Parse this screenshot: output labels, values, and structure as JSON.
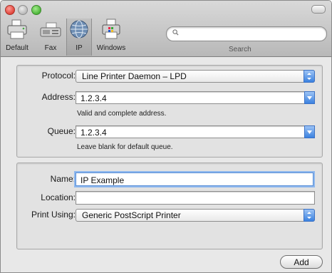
{
  "toolbar": {
    "items": [
      {
        "label": "Default",
        "icon": "printer-icon"
      },
      {
        "label": "Fax",
        "icon": "fax-icon"
      },
      {
        "label": "IP",
        "icon": "globe-icon"
      },
      {
        "label": "Windows",
        "icon": "windows-printer-icon"
      }
    ],
    "search_label": "Search",
    "search_value": ""
  },
  "form1": {
    "protocol_label": "Protocol:",
    "protocol_value": "Line Printer Daemon – LPD",
    "address_label": "Address:",
    "address_value": "1.2.3.4",
    "address_hint": "Valid and complete address.",
    "queue_label": "Queue:",
    "queue_value": "1.2.3.4",
    "queue_hint": "Leave blank for default queue."
  },
  "form2": {
    "name_label": "Name:",
    "name_value": "IP Example",
    "location_label": "Location:",
    "location_value": "",
    "print_using_label": "Print Using:",
    "print_using_value": "Generic PostScript Printer"
  },
  "add_label": "Add",
  "colors": {
    "accent": "#3b82e0",
    "close": "#e0443a",
    "zoom": "#4db53a"
  }
}
